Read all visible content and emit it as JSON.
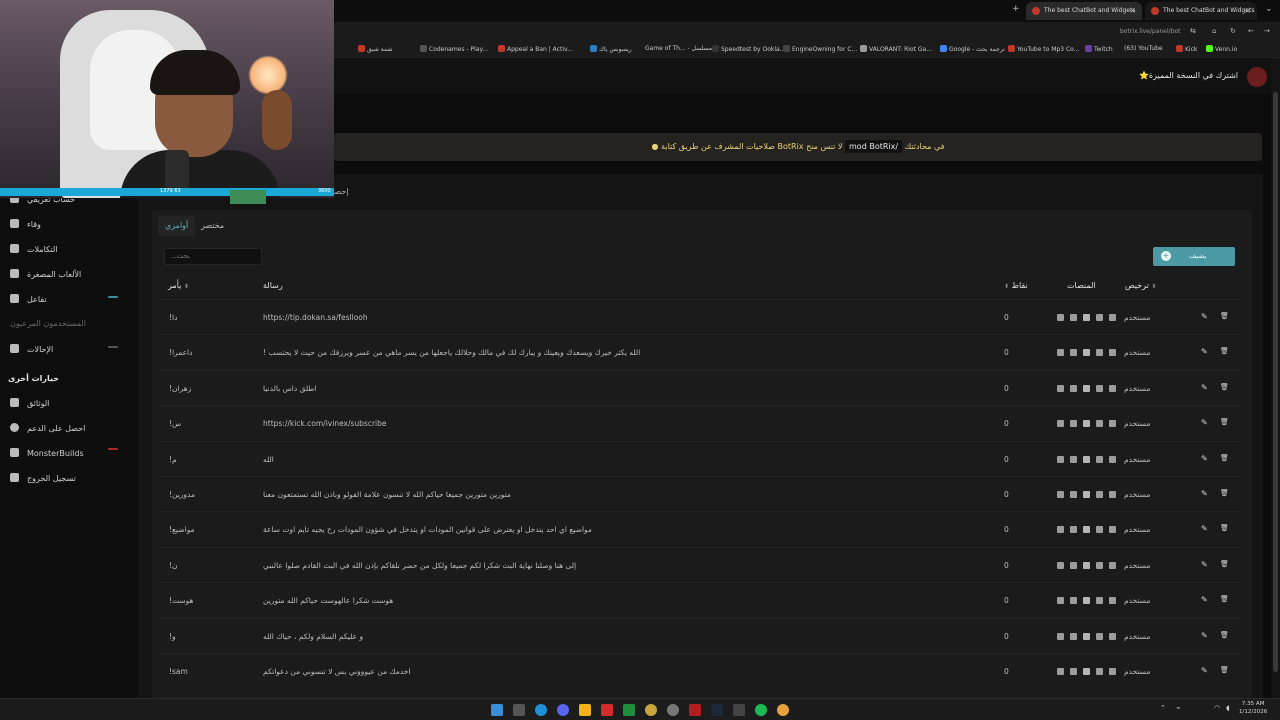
{
  "browser": {
    "tabs": [
      {
        "title": "The best ChatBot and Widgets"
      },
      {
        "title": "The best ChatBot and Widgets"
      }
    ],
    "url": "botrix.live/panel/bot",
    "bookmarks": [
      "شمة شيق",
      "Codenames - Play...",
      "Appeal a Ban | Activ...",
      "ريسوبس ياك",
      "Game of Th... - مسلسل",
      "Speedtest by Ookla...",
      "EngineOwning for C...",
      "VALORANT: Riot Ga...",
      "Google - ترجمة بحث",
      "YouTube to Mp3 Co...",
      "Twitch",
      "(63) YouTube",
      "Kick",
      "Venn.io"
    ]
  },
  "webcam": {
    "overlay_left": "1379 63",
    "overlay_right": "3600"
  },
  "header": {
    "premium_label": "اشترك في النسخة المميزة⭐"
  },
  "alert": {
    "text_before": "في محادثتك",
    "command": "/mod BotRix",
    "text_after": "لا تنس منح BotRix صلاحيات المشرف عن طريق كتابة"
  },
  "page_tab_partial": "إحصا",
  "sidebar": {
    "items": [
      {
        "label": "حساب تعريفي",
        "icon": "user-icon"
      },
      {
        "label": "وقاء",
        "icon": "trophy-icon"
      },
      {
        "label": "التكاملات",
        "icon": "puzzle-icon"
      },
      {
        "label": "الألعاب المصغرة",
        "icon": "gamepad-icon"
      },
      {
        "label": "تفاعل",
        "icon": "music-icon"
      },
      {
        "label": "المستخدمون المرعيون",
        "icon": "users-icon"
      },
      {
        "label": "الإحالات",
        "icon": "people-icon"
      }
    ],
    "other_header": "خيارات أخرى",
    "other_items": [
      {
        "label": "الوثائق",
        "icon": "book-icon"
      },
      {
        "label": "احصل على الدعم",
        "icon": "help-icon"
      },
      {
        "label": "MonsterBuilds",
        "icon": "laptop-icon"
      },
      {
        "label": "تسجيل الخروج",
        "icon": "logout-icon"
      }
    ]
  },
  "tabs": {
    "commands": "أوامري",
    "shortcut": "مختصر"
  },
  "search": {
    "placeholder": "بحث..."
  },
  "add_button": {
    "label": "يضيف"
  },
  "table": {
    "headers": {
      "command": "يأمر",
      "message": "رسالة",
      "points": "نقاط",
      "platforms": "المنصات",
      "permission": "ترخيص"
    },
    "rows": [
      {
        "command": "!دا",
        "message": "https://tip.dokan.sa/fesllooh",
        "points": "0",
        "permission": "مستخدم"
      },
      {
        "command": "!داعمرا",
        "message": "الله يكثر خيرك ويسعدك ويعينك و يبارك لك في مالك وحلالك ياجعلها من يسر ماهي من عسر ويرزقك من حيث لا يحتسب !",
        "points": "0",
        "permission": "مستخدم"
      },
      {
        "command": "!زهران",
        "message": "اطلق داس بالدنيا",
        "points": "0",
        "permission": "مستخدم"
      },
      {
        "command": "!س",
        "message": "https://kick.com/ivinex/subscribe",
        "points": "0",
        "permission": "مستخدم"
      },
      {
        "command": "!م",
        "message": "الله",
        "points": "0",
        "permission": "مستخدم"
      },
      {
        "command": "!مدورين",
        "message": "متورين متورين جميعا حياكم الله لا تنسون علامة الفولو وباذن الله تستمتعون معنا",
        "points": "0",
        "permission": "مستخدم"
      },
      {
        "command": "!مواضيع",
        "message": "مواضيع اي احد يتدخل او يعترض على قوانين المودات او يتدخل في شؤون المودات رح يجيه تايم اوت ساعة",
        "points": "0",
        "permission": "مستخدم"
      },
      {
        "command": "!ن",
        "message": "إلى هنا وصلنا نهاية البث شكرا لكم جميعا ولكل من حضر نلقاكم بإذن الله في البث القادم صلوا عالنبي",
        "points": "0",
        "permission": "مستخدم"
      },
      {
        "command": "!هوست",
        "message": "هوست شكرا عالهوست حياكم الله متورين",
        "points": "0",
        "permission": "مستخدم"
      },
      {
        "command": "!و",
        "message": "و عليكم السلام ولكم ، حياك الله",
        "points": "0",
        "permission": "مستخدم"
      },
      {
        "command": "!sam",
        "message": "اخدمك من عيوووني بس لا تنسوني من دعواتكم",
        "points": "0",
        "permission": "مستخدم"
      }
    ]
  },
  "taskbar": {
    "time": "7:35 AM",
    "date": "1/12/2026"
  },
  "colors": {
    "accent": "#4b9aa6",
    "alert_text": "#e8d07a",
    "webcam_bar": "#1aa9d6"
  }
}
